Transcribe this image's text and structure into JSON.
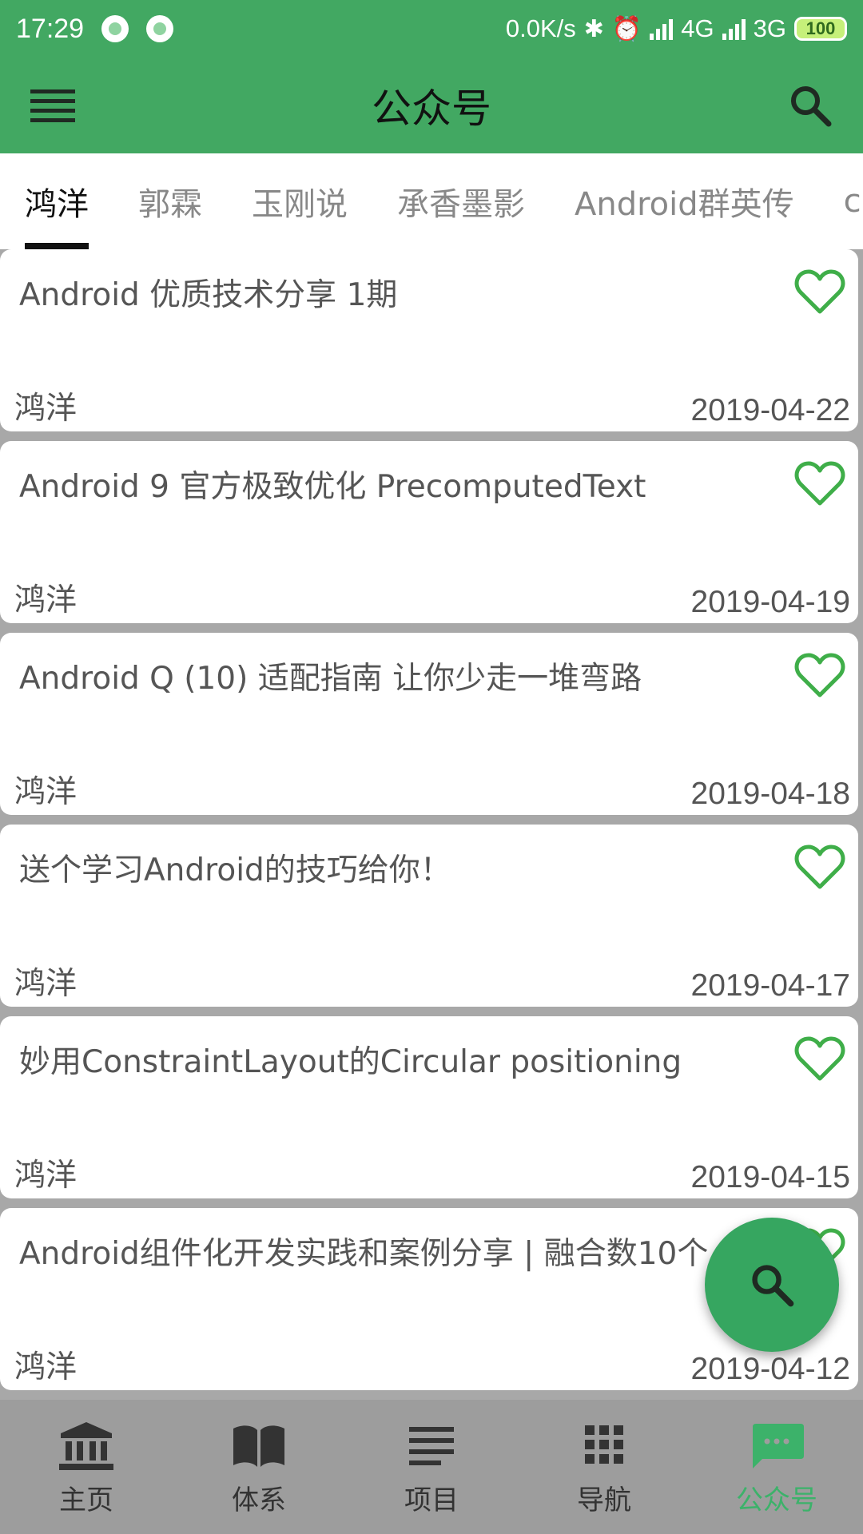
{
  "status_bar": {
    "time": "17:29",
    "net_speed": "0.0K/s",
    "network_1": "4G",
    "network_2": "3G",
    "battery": "100"
  },
  "toolbar": {
    "title": "公众号"
  },
  "tabs": [
    {
      "label": "鸿洋",
      "active": true
    },
    {
      "label": "郭霖",
      "active": false
    },
    {
      "label": "玉刚说",
      "active": false
    },
    {
      "label": "承香墨影",
      "active": false
    },
    {
      "label": "Android群英传",
      "active": false
    },
    {
      "label": "c",
      "active": false
    }
  ],
  "articles": [
    {
      "title": "Android 优质技术分享 1期",
      "author": "鸿洋",
      "date": "2019-04-22"
    },
    {
      "title": "Android 9 官方极致优化 PrecomputedText",
      "author": "鸿洋",
      "date": "2019-04-19"
    },
    {
      "title": "Android Q (10) 适配指南 让你少走一堆弯路",
      "author": "鸿洋",
      "date": "2019-04-18"
    },
    {
      "title": "送个学习Android的技巧给你！",
      "author": "鸿洋",
      "date": "2019-04-17"
    },
    {
      "title": "妙用ConstraintLayout的Circular positioning",
      "author": "鸿洋",
      "date": "2019-04-15"
    },
    {
      "title": "Android组件化开发实践和案例分享 | 融合数10个",
      "author": "鸿洋",
      "date": "2019-04-12"
    }
  ],
  "bottom_nav": [
    {
      "label": "主页",
      "icon": "bank-icon",
      "active": false
    },
    {
      "label": "体系",
      "icon": "book-icon",
      "active": false
    },
    {
      "label": "项目",
      "icon": "lines-icon",
      "active": false
    },
    {
      "label": "导航",
      "icon": "grid-icon",
      "active": false
    },
    {
      "label": "公众号",
      "icon": "chat-icon",
      "active": true
    }
  ],
  "colors": {
    "primary": "#42a862",
    "accent": "#3cb26a",
    "heart": "#3fae49"
  }
}
